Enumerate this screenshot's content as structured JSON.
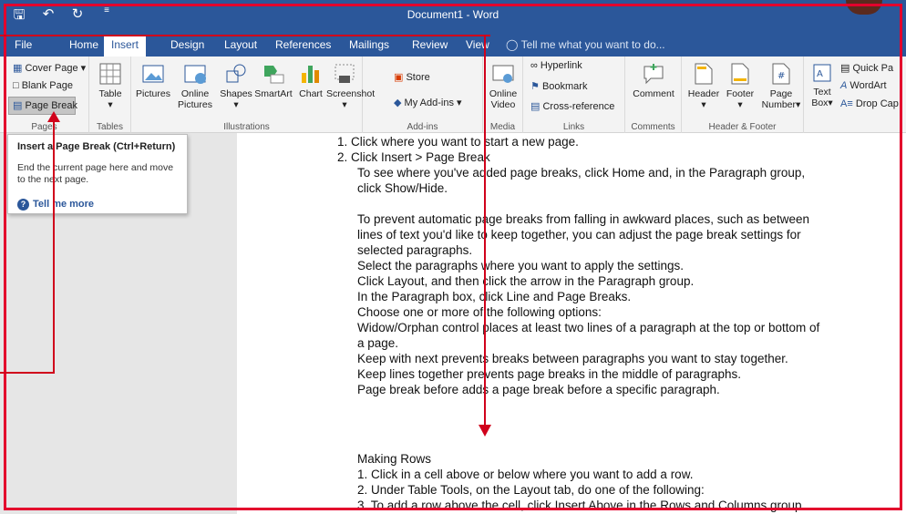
{
  "titlebar": {
    "title": "Document1 - Word",
    "qat": [
      "save-icon",
      "undo-icon",
      "redo-icon",
      "customize-icon"
    ]
  },
  "tabs": [
    "File",
    "Home",
    "Insert",
    "Design",
    "Layout",
    "References",
    "Mailings",
    "Review",
    "View"
  ],
  "active_tab": "Insert",
  "tell_me": "Tell me what you want to do...",
  "ribbon": {
    "pages": {
      "label": "Pages",
      "cover_page": "Cover Page",
      "blank_page": "Blank Page",
      "page_break": "Page Break"
    },
    "tables": {
      "label": "Tables",
      "table": "Table"
    },
    "illustrations": {
      "label": "Illustrations",
      "pictures": "Pictures",
      "online_pictures_1": "Online",
      "online_pictures_2": "Pictures",
      "shapes": "Shapes",
      "smartart": "SmartArt",
      "chart": "Chart",
      "screenshot": "Screenshot"
    },
    "addins": {
      "label": "Add-ins",
      "store": "Store",
      "my_addins": "My Add-ins"
    },
    "media": {
      "label": "Media",
      "online_video_1": "Online",
      "online_video_2": "Video"
    },
    "links": {
      "label": "Links",
      "hyperlink": "Hyperlink",
      "bookmark": "Bookmark",
      "cross_reference": "Cross-reference"
    },
    "comments": {
      "label": "Comments",
      "comment": "Comment"
    },
    "header_footer": {
      "label": "Header & Footer",
      "header": "Header",
      "footer": "Footer",
      "page_number_1": "Page",
      "page_number_2": "Number"
    },
    "text": {
      "text_box_1": "Text",
      "text_box_2": "Box",
      "quick_parts": "Quick Pa",
      "wordart": "WordArt",
      "drop_cap": "Drop Cap"
    }
  },
  "tooltip": {
    "title": "Insert a Page Break (Ctrl+Return)",
    "body": "End the current page here and move to the next page.",
    "more": "Tell me more"
  },
  "document": {
    "lines": [
      "1.  Click where you want to start a new page.",
      "2.  Click Insert > Page Break",
      "To see where you've added page breaks, click Home and, in the Paragraph group,",
      "click Show/Hide.",
      "",
      "To prevent automatic page breaks from falling in awkward places, such as between",
      "lines of text you'd like to keep together, you can adjust the page break settings for",
      "selected paragraphs.",
      "Select the paragraphs where you want to apply the settings.",
      "Click Layout, and then click the arrow in the Paragraph group.",
      "In the Paragraph box, click Line and Page Breaks.",
      "Choose one or more of the following options:",
      "Widow/Orphan control places at least two lines of a paragraph at the top or bottom of",
      "a page.",
      "Keep with next prevents breaks between paragraphs you want to stay together.",
      "Keep lines together prevents page breaks in the middle of paragraphs.",
      "Page break before adds a page break before a specific paragraph."
    ],
    "rows_heading": "Making Rows",
    "rows_lines": [
      "1.  Click in a cell above or below where you want to add a row.",
      "2.  Under Table Tools, on the Layout tab, do one of the following:",
      "3.  To add a row above the cell, click Insert Above in the Rows and Columns group."
    ]
  },
  "colors": {
    "word_blue": "#2b579a",
    "annotation_red": "#d0021b"
  }
}
